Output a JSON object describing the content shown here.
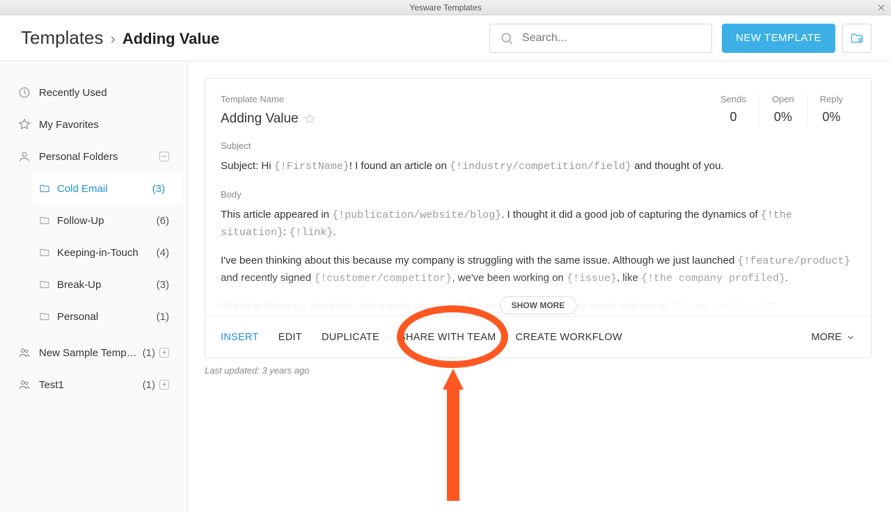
{
  "window": {
    "title": "Yesware Templates"
  },
  "header": {
    "breadcrumb_root": "Templates",
    "breadcrumb_current": "Adding Value",
    "search_placeholder": "Search...",
    "new_template_label": "NEW TEMPLATE"
  },
  "sidebar": {
    "recent_label": "Recently Used",
    "favorites_label": "My Favorites",
    "personal_folders_label": "Personal Folders",
    "folders": [
      {
        "label": "Cold Email",
        "count": "(3)",
        "active": true
      },
      {
        "label": "Follow-Up",
        "count": "(6)"
      },
      {
        "label": "Keeping-in-Touch",
        "count": "(4)"
      },
      {
        "label": "Break-Up",
        "count": "(3)"
      },
      {
        "label": "Personal",
        "count": "(1)"
      }
    ],
    "team_folders": [
      {
        "label": "New Sample Templa...",
        "count": "(1)"
      },
      {
        "label": "Test1",
        "count": "(1)"
      }
    ]
  },
  "template": {
    "name_label": "Template Name",
    "name": "Adding Value",
    "stats": {
      "sends_label": "Sends",
      "sends_value": "0",
      "open_label": "Open",
      "open_value": "0%",
      "reply_label": "Reply",
      "reply_value": "0%"
    },
    "subject_label": "Subject",
    "subject_prefix": "Subject: Hi ",
    "subject_ph1": "{!FirstName}",
    "subject_mid": "! I found an article on ",
    "subject_ph2": "{!industry/competition/field}",
    "subject_end": " and thought of you.",
    "body_label": "Body",
    "body1_a": "This article appeared in ",
    "body1_ph1": "{!publication/website/blog}",
    "body1_b": ". I thought it did a good job of capturing the dynamics of ",
    "body1_ph2": "{!the situation}",
    "body1_c": ": ",
    "body1_ph3": "{!link}",
    "body1_d": ".",
    "body2_a": "I've been thinking about this because my company is struggling with the same issue. Although we just launched ",
    "body2_ph1": "{!feature/product}",
    "body2_b": " and recently signed ",
    "body2_ph2": "{!customer/competitor}",
    "body2_c": ", we've been working on ",
    "body2_ph3": "{!issue}",
    "body2_d": ", like ",
    "body2_ph4": "{!the company profiled}",
    "body2_e": ".",
    "body3_a": "I'd like to follow up about this with a quick phone call. Do you have 5 minutes to speak with me at ",
    "body3_ph1": "{!time and date}",
    "body3_b": "?",
    "show_more": "SHOW MORE"
  },
  "actions": {
    "insert": "INSERT",
    "edit": "EDIT",
    "duplicate": "DUPLICATE",
    "share": "SHARE WITH TEAM",
    "workflow": "CREATE WORKFLOW",
    "more": "MORE"
  },
  "meta": {
    "last_updated": "Last updated: 3 years ago"
  }
}
